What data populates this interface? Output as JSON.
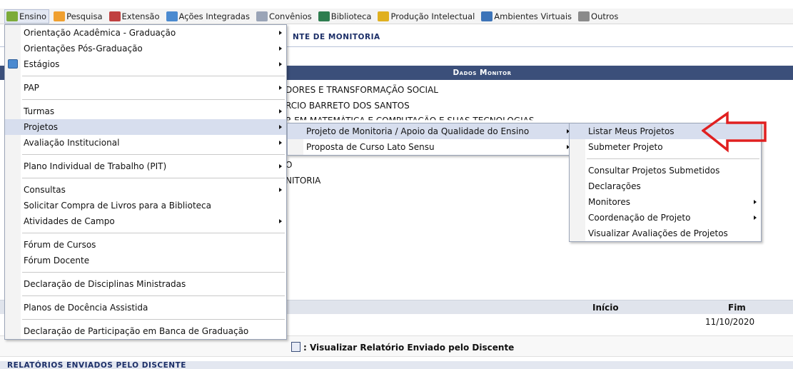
{
  "menubar": {
    "items": [
      {
        "label": "Ensino",
        "icon": "book-icon",
        "color": "#7cab3a"
      },
      {
        "label": "Pesquisa",
        "icon": "flask-icon",
        "color": "#f0a030"
      },
      {
        "label": "Extensão",
        "icon": "heart-icon",
        "color": "#c04040"
      },
      {
        "label": "Ações Integradas",
        "icon": "puzzle-icon",
        "color": "#4b8ad0"
      },
      {
        "label": "Convênios",
        "icon": "document-icon",
        "color": "#9aa4b7"
      },
      {
        "label": "Biblioteca",
        "icon": "library-icon",
        "color": "#2e7d4f"
      },
      {
        "label": "Produção Intelectual",
        "icon": "notebook-icon",
        "color": "#e0b020"
      },
      {
        "label": "Ambientes Virtuais",
        "icon": "network-icon",
        "color": "#3d74b8"
      },
      {
        "label": "Outros",
        "icon": "gear-icon",
        "color": "#8a8a8a"
      }
    ]
  },
  "background": {
    "title_fragment": "NTE DE MONITORIA",
    "section_header": "Dados Monitor",
    "line1": "DORES E TRANSFORMAÇÃO SOCIAL",
    "line2": "RCIO BARRETO DOS SANTOS",
    "line3": "R EM MATEMÁTICA E COMPUTAÇÃO E SUAS TECNOLOGIAS",
    "line4": "O",
    "line5": "NITORIA",
    "col_inicio": "Início",
    "col_fim": "Fim",
    "row_fim": "11/10/2020",
    "legend": ": Visualizar Relatório Enviado pelo Discente",
    "bottom_header": "RELATÓRIOS ENVIADOS PELO DISCENTE"
  },
  "menu1": {
    "items": [
      {
        "label": "Orientação Acadêmica - Graduação",
        "sub": true
      },
      {
        "label": "Orientações Pós-Graduação",
        "sub": true
      },
      {
        "label": "Estágios",
        "sub": true,
        "icon": "internship-icon"
      },
      {
        "sep": true
      },
      {
        "label": "PAP",
        "sub": true
      },
      {
        "sep": true
      },
      {
        "label": "Turmas",
        "sub": true
      },
      {
        "label": "Projetos",
        "sub": true,
        "selected": true
      },
      {
        "label": "Avaliação Institucional",
        "sub": true
      },
      {
        "sep": true
      },
      {
        "label": "Plano Individual de Trabalho (PIT)",
        "sub": true
      },
      {
        "sep": true
      },
      {
        "label": "Consultas",
        "sub": true
      },
      {
        "label": "Solicitar Compra de Livros para a Biblioteca",
        "sub": false
      },
      {
        "label": "Atividades de Campo",
        "sub": true
      },
      {
        "sep": true
      },
      {
        "label": "Fórum de Cursos",
        "sub": false
      },
      {
        "label": "Fórum Docente",
        "sub": false
      },
      {
        "sep": true
      },
      {
        "label": "Declaração de Disciplinas Ministradas",
        "sub": false
      },
      {
        "sep": true
      },
      {
        "label": "Planos de Docência Assistida",
        "sub": false
      },
      {
        "sep": true
      },
      {
        "label": "Declaração de Participação em Banca de Graduação",
        "sub": false
      }
    ]
  },
  "menu2": {
    "items": [
      {
        "label": "Projeto de Monitoria / Apoio da Qualidade do Ensino",
        "sub": true,
        "selected": true
      },
      {
        "label": "Proposta de Curso Lato Sensu",
        "sub": true
      }
    ]
  },
  "menu3": {
    "items": [
      {
        "label": "Listar Meus Projetos",
        "sub": false,
        "selected": true
      },
      {
        "label": "Submeter Projeto",
        "sub": false
      },
      {
        "sep": true
      },
      {
        "label": "Consultar Projetos Submetidos",
        "sub": false
      },
      {
        "label": "Declarações",
        "sub": false
      },
      {
        "label": "Monitores",
        "sub": true
      },
      {
        "label": "Coordenação de Projeto",
        "sub": true
      },
      {
        "label": "Visualizar Avaliações de Projetos",
        "sub": false
      }
    ]
  },
  "annotation": {
    "arrow_color": "#e02020"
  }
}
